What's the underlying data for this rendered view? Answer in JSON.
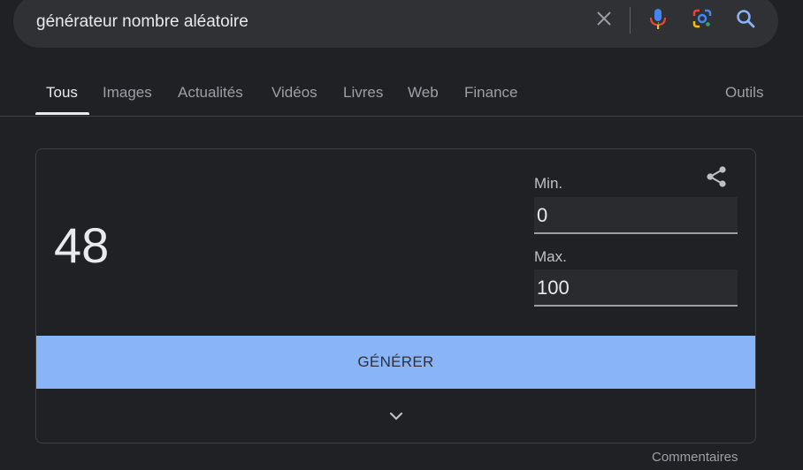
{
  "search": {
    "query": "générateur nombre aléatoire",
    "icons": [
      "close-icon",
      "microphone-icon",
      "google-lens-icon",
      "search-icon"
    ]
  },
  "tabs": [
    {
      "label": "Tous",
      "active": true
    },
    {
      "label": "Images"
    },
    {
      "label": "Actualités"
    },
    {
      "label": "Vidéos"
    },
    {
      "label": "Livres"
    },
    {
      "label": "Web"
    },
    {
      "label": "Finance"
    }
  ],
  "tools_label": "Outils",
  "generator": {
    "result": "48",
    "min_label": "Min.",
    "min_value": "0",
    "max_label": "Max.",
    "max_value": "100",
    "button_label": "GÉNÉRER"
  },
  "feedback_label": "Commentaires",
  "colors": {
    "background": "#202124",
    "searchbar": "#303134",
    "button": "#8ab4f8",
    "text": "#e8eaed",
    "muted": "#9aa0a6"
  }
}
